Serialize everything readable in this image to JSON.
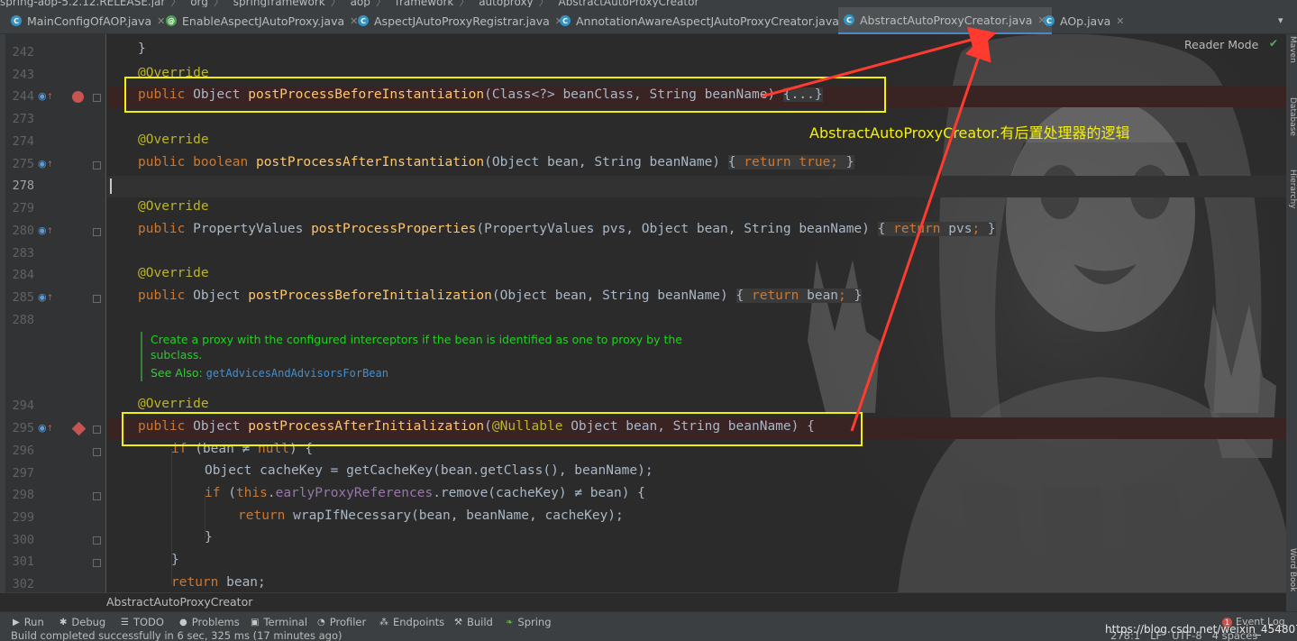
{
  "breadcrumbs": [
    "spring-aop-5.2.12.RELEASE.jar",
    "org",
    "springframework",
    "aop",
    "framework",
    "autoproxy",
    "AbstractAutoProxyCreator"
  ],
  "tabs": [
    {
      "label": "MainConfigOfAOP.java",
      "active": false
    },
    {
      "label": "EnableAspectJAutoProxy.java",
      "active": false
    },
    {
      "label": "AspectJAutoProxyRegistrar.java",
      "active": false
    },
    {
      "label": "AnnotationAwareAspectJAutoProxyCreator.java",
      "active": false
    },
    {
      "label": "AbstractAutoProxyCreator.java",
      "active": true
    },
    {
      "label": "AOp.java",
      "active": false
    }
  ],
  "right_strip": [
    "Maven",
    "Database",
    "Hierarchy",
    "Word Book"
  ],
  "reader_mode": "Reader Mode",
  "line_numbers": [
    "242",
    "243",
    "244",
    "273",
    "274",
    "275",
    "278",
    "279",
    "280",
    "283",
    "284",
    "285",
    "288",
    "294",
    "295",
    "296",
    "297",
    "298",
    "299",
    "300",
    "301",
    "302"
  ],
  "code": {
    "l242": "}",
    "l243": "@Override",
    "l244": [
      "public",
      "Object",
      "postProcessBeforeInstantiation",
      "(Class<?> beanClass, String beanName)",
      "{...}"
    ],
    "l274": "@Override",
    "l275": [
      "public",
      "boolean",
      "postProcessAfterInstantiation",
      "(Object bean, String beanName)",
      "{",
      "return",
      "true",
      ";",
      "}"
    ],
    "l279": "@Override",
    "l280": [
      "public",
      "PropertyValues",
      "postProcessProperties",
      "(PropertyValues pvs, Object bean, String beanName)",
      "{",
      "return",
      "pvs",
      ";",
      "}"
    ],
    "l284": "@Override",
    "l285": [
      "public",
      "Object",
      "postProcessBeforeInitialization",
      "(Object bean, String beanName)",
      "{",
      "return",
      "bean",
      ";",
      "}"
    ],
    "l294": "@Override",
    "l295": [
      "public",
      "Object",
      "postProcessAfterInitialization",
      "(",
      "@Nullable",
      " Object bean, String beanName) {"
    ],
    "l296": [
      "if",
      " (bean ≠ ",
      "null",
      ") {"
    ],
    "l297": "Object cacheKey = getCacheKey(bean.getClass(), beanName);",
    "l298": [
      "if",
      " (",
      "this",
      ".",
      "earlyProxyReferences",
      ".remove(cacheKey) ≠ bean) {"
    ],
    "l299": [
      "return",
      " wrapIfNecessary(bean, beanName, cacheKey);"
    ],
    "l300": "}",
    "l301": "}",
    "l302": [
      "return",
      " bean;"
    ]
  },
  "doc": {
    "text": "Create a proxy with the configured interceptors if the bean is identified as one to proxy by the subclass.",
    "see_label": "See Also:",
    "see_link": "getAdvicesAndAdvisorsForBean"
  },
  "annotation_note": "AbstractAutoProxyCreator.有后置处理器的逻辑",
  "editor_breadcrumb": "AbstractAutoProxyCreator",
  "tool_windows": [
    "Run",
    "Debug",
    "TODO",
    "Problems",
    "Terminal",
    "Profiler",
    "Endpoints",
    "Build",
    "Spring"
  ],
  "event_log": {
    "count": "1",
    "label": "Event Log"
  },
  "status": {
    "message": "Build completed successfully in 6 sec, 325 ms (17 minutes ago)",
    "position": "278:1",
    "line_sep": "LF",
    "encoding": "UTF-8",
    "indent": "4 spaces"
  },
  "watermark": "https://blog.csdn.net/weixin_45480785",
  "colors": {
    "highlight_box": "#f5f006",
    "arrow": "#ff3b30",
    "keyword": "#cc7832",
    "method": "#ffc66d",
    "annotation": "#bbb529"
  }
}
